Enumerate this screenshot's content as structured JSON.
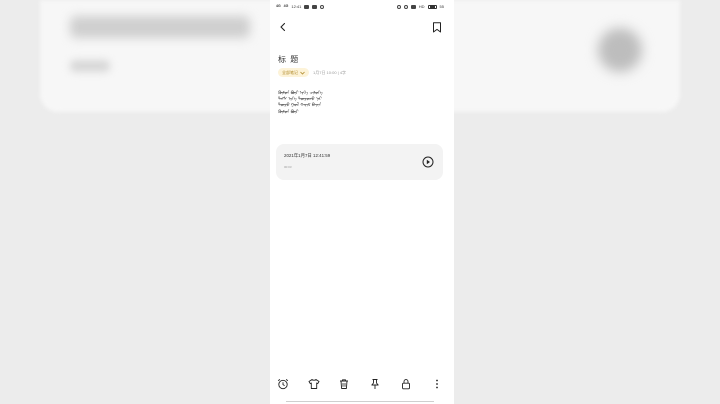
{
  "status_bar": {
    "signal_1": "4G",
    "signal_2": "4G",
    "time": "12:41",
    "network": "HD",
    "battery": "55"
  },
  "note": {
    "title_small": "ㅤ ㅤ",
    "title": "标 题",
    "folder": "全部笔记",
    "meta": "1月7日 10:00 | 4字",
    "body_lines": [
      "ᠬᠥᠮᠦᠨ ᠪᠦᠷ ᠡᠷᠬᠡ ᠴᠢᠯᠥᠭᠡ",
      "ᠲᠡᠭᠰ ᠡᠷᠬᠡ ᠲᠥᠷᠥᠵᠥ ᠨᠡᠷ",
      "ᠲᠥᠷᠥ ᠭᠣᠯ ᠬᠠᠷᠢᠮ ᠪᠠᠶᠢᠨ",
      "ᠬᠥᠮᠦᠨ ᠪᠦᠷ"
    ]
  },
  "audio": {
    "title": "2021年1月7日 12:41:59",
    "duration": "00:03"
  },
  "colors": {
    "accent": "#f0c44c",
    "chip_bg": "#fdf3d8",
    "card_bg": "#f3f3f3"
  },
  "toolbar": {
    "icons": [
      "alarm-icon",
      "shirt-icon",
      "trash-icon",
      "pin-icon",
      "lock-icon",
      "more-icon"
    ]
  }
}
